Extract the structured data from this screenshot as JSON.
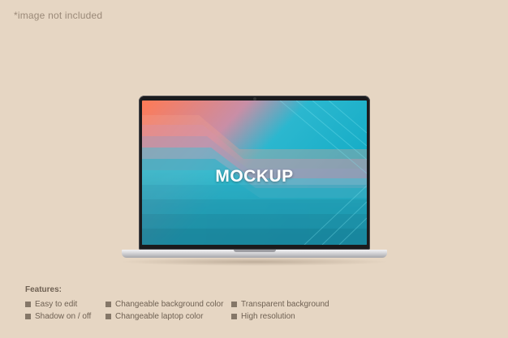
{
  "note": "*image not included",
  "screen": {
    "text": "MOCKUP"
  },
  "features": {
    "title": "Features:",
    "items": [
      "Easy to edit",
      "Shadow on / off",
      "Changeable background color",
      "Changeable laptop color",
      "Transparent background",
      "High resolution"
    ]
  },
  "colors": {
    "background": "#e6d6c3",
    "screen_warm": "#ff8a6a",
    "screen_cool": "#1fc8d8",
    "laptop_frame": "#1b1b1d",
    "laptop_body": "#c7c7ca"
  }
}
